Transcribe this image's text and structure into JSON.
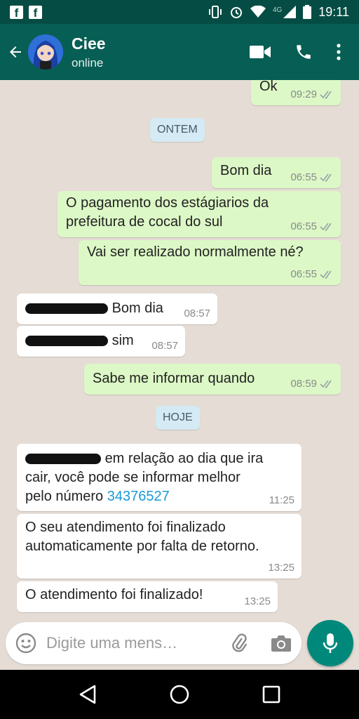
{
  "statusbar": {
    "network": "4G",
    "time": "19:11"
  },
  "header": {
    "contact_name": "Ciee",
    "contact_status": "online"
  },
  "chat": {
    "m0": {
      "text": "Ok",
      "time": "09:29"
    },
    "date1": "ONTEM",
    "m1": {
      "text": "Bom dia",
      "time": "06:55"
    },
    "m2": {
      "line1": "O pagamento dos estágiarios da",
      "line2": "prefeitura de cocal do sul",
      "time": "06:55"
    },
    "m3": {
      "text": "Vai ser realizado normalmente né?",
      "time": "06:55"
    },
    "m4": {
      "text": "Bom dia",
      "time": "08:57"
    },
    "m5": {
      "text": "sim",
      "time": "08:57"
    },
    "m6": {
      "text": "Sabe me informar quando",
      "time": "08:59"
    },
    "date2": "HOJE",
    "m7": {
      "line1": "em relação ao dia que ira",
      "line2": "cair, você pode se informar melhor",
      "line3": "pelo número",
      "number": "34376527",
      "time": "11:25"
    },
    "m8": {
      "line1": "O seu atendimento foi finalizado",
      "line2": "automaticamente por falta de retorno.",
      "time": "13:25"
    },
    "m9": {
      "text": "O atendimento foi finalizado!",
      "time": "13:25"
    }
  },
  "composer": {
    "placeholder": "Digite uma mens…"
  },
  "colors": {
    "header": "#075e54",
    "outgoing": "#dcf8c6",
    "incoming": "#ffffff",
    "accent": "#00897b"
  },
  "icons": [
    "back-arrow-icon",
    "video-call-icon",
    "phone-icon",
    "more-icon",
    "emoji-icon",
    "attach-icon",
    "camera-icon",
    "mic-icon",
    "nav-back-icon",
    "nav-home-icon",
    "nav-recents-icon"
  ]
}
